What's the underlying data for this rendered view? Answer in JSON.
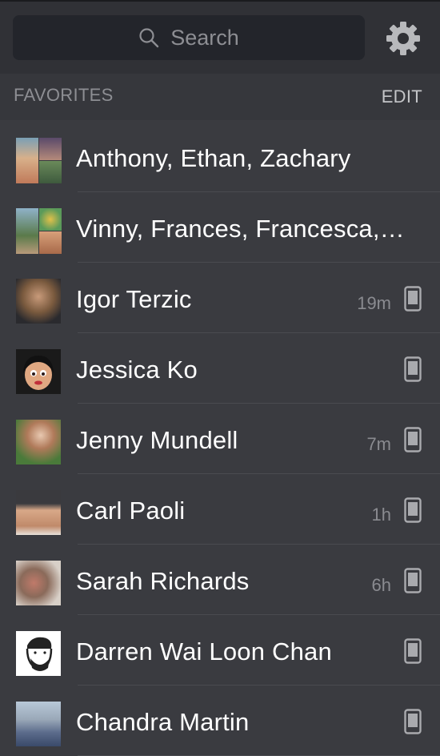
{
  "search": {
    "placeholder": "Search"
  },
  "section": {
    "title": "FAVORITES",
    "edit_label": "EDIT"
  },
  "contacts": [
    {
      "name": "Anthony, Ethan, Zachary",
      "time": "",
      "phone": false
    },
    {
      "name": "Vinny, Frances, Francesca,…",
      "time": "",
      "phone": false
    },
    {
      "name": "Igor Terzic",
      "time": "19m",
      "phone": true
    },
    {
      "name": "Jessica Ko",
      "time": "",
      "phone": true
    },
    {
      "name": "Jenny Mundell",
      "time": "7m",
      "phone": true
    },
    {
      "name": "Carl Paoli",
      "time": "1h",
      "phone": true
    },
    {
      "name": "Sarah Richards",
      "time": "6h",
      "phone": true
    },
    {
      "name": "Darren Wai Loon Chan",
      "time": "",
      "phone": true
    },
    {
      "name": "Chandra Martin",
      "time": "",
      "phone": true
    }
  ],
  "icons": {
    "search": "search-icon",
    "settings": "gear-icon",
    "device": "mobile-phone-icon"
  }
}
